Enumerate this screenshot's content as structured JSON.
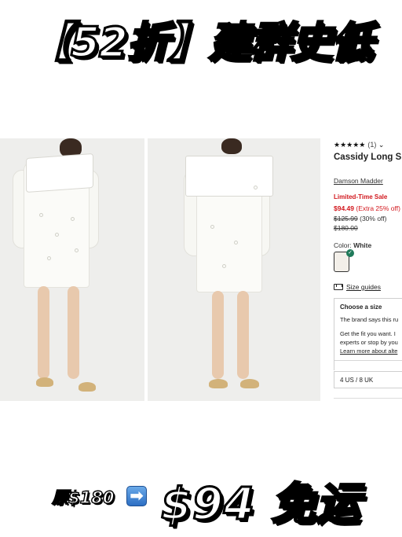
{
  "banner": {
    "headline": "【52折】建群史低"
  },
  "product": {
    "rating_stars": "★★★★★",
    "rating_count": "(1)",
    "title": "Cassidy Long Sleeve Minidress",
    "brand": "Damson Madder",
    "deal_label": "Limited-Time Sale",
    "sale_price": "$94.49",
    "extra_discount": "(Extra 25% off)",
    "was_price": "$125.99",
    "was_discount": "(30% off)",
    "original_price": "$180.00",
    "color_label": "Color:",
    "color_value": "White",
    "size_guides": "Size guides",
    "size_box": {
      "heading": "Choose a size",
      "line1": "The brand says this ru",
      "line2": "Get the fit you want. I",
      "line3": "experts or stop by you",
      "line4": "Learn more about alte"
    },
    "selected_size": "4 US / 8 UK"
  },
  "promo": {
    "original": "原$180",
    "arrow": "➡",
    "final": "$94 免运"
  },
  "colors": {
    "sale_red": "#d2181e",
    "check_green": "#1f7a5a",
    "arrow_blue": "#2d6fc4"
  }
}
